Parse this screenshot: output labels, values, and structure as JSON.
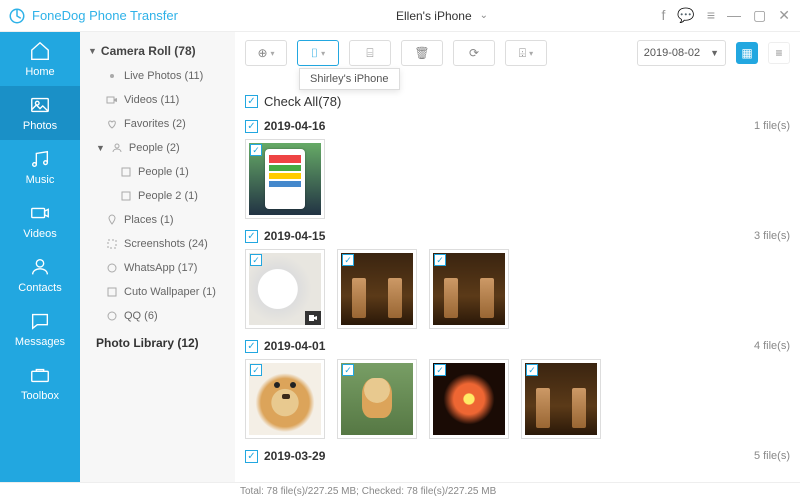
{
  "app": {
    "title": "FoneDog Phone Transfer"
  },
  "device": {
    "name": "Ellen's iPhone"
  },
  "nav": {
    "home": "Home",
    "photos": "Photos",
    "music": "Music",
    "videos": "Videos",
    "contacts": "Contacts",
    "messages": "Messages",
    "toolbox": "Toolbox"
  },
  "sidebar": {
    "camera_roll": "Camera Roll (78)",
    "live_photos": "Live Photos (11)",
    "videos": "Videos (11)",
    "favorites": "Favorites (2)",
    "people": "People (2)",
    "people1": "People (1)",
    "people2": "People 2 (1)",
    "places": "Places (1)",
    "screenshots": "Screenshots (24)",
    "whatsapp": "WhatsApp (17)",
    "cuto": "Cuto Wallpaper (1)",
    "qq": "QQ (6)",
    "photo_library": "Photo Library (12)"
  },
  "toolbar": {
    "tooltip": "Shirley's iPhone",
    "date_filter": "2019-08-02"
  },
  "checkall": "Check All(78)",
  "groups": {
    "g1_date": "2019-04-16",
    "g1_count": "1 file(s)",
    "g2_date": "2019-04-15",
    "g2_count": "3 file(s)",
    "g3_date": "2019-04-01",
    "g3_count": "4 file(s)",
    "g4_date": "2019-03-29",
    "g4_count": "5 file(s)"
  },
  "footer": "Total: 78 file(s)/227.25 MB; Checked: 78 file(s)/227.25 MB"
}
